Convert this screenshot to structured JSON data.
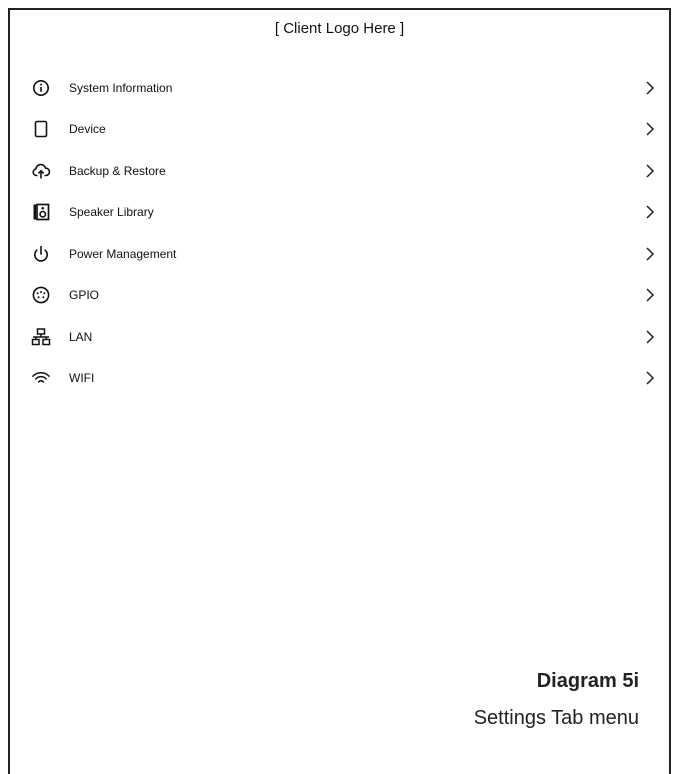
{
  "header": {
    "logo_text": "[ Client Logo Here ]"
  },
  "menu": {
    "items": [
      {
        "label": "System Information",
        "icon": "info-icon"
      },
      {
        "label": "Device",
        "icon": "device-icon"
      },
      {
        "label": "Backup & Restore",
        "icon": "cloud-upload-icon"
      },
      {
        "label": "Speaker Library",
        "icon": "speaker-icon"
      },
      {
        "label": "Power Management",
        "icon": "power-icon"
      },
      {
        "label": "GPIO",
        "icon": "gpio-connector-icon"
      },
      {
        "label": "LAN",
        "icon": "lan-network-icon"
      },
      {
        "label": "WIFI",
        "icon": "wifi-icon"
      }
    ]
  },
  "caption": {
    "title": "Diagram 5i",
    "subtitle": "Settings Tab menu"
  }
}
